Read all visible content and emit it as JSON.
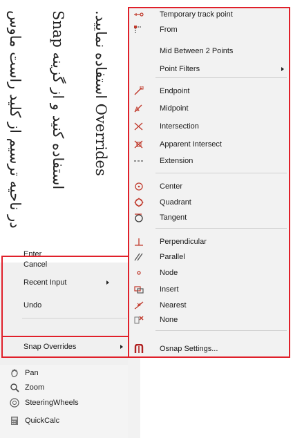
{
  "annotation": {
    "line1": "در ناحیه ترسیم از کلید راست ماوس",
    "line2": "استفاده کنید و از گزینه Snap",
    "line3": "Overrides استفاده نمایید."
  },
  "context_menu": {
    "items": [
      {
        "label": "Enter"
      },
      {
        "label": "Cancel"
      },
      {
        "label": "Recent Input"
      },
      {
        "label": "Undo"
      },
      {
        "label": "Snap Overrides"
      },
      {
        "label": "Pan"
      },
      {
        "label": "Zoom"
      },
      {
        "label": "SteeringWheels"
      },
      {
        "label": "QuickCalc"
      }
    ]
  },
  "snap_submenu": {
    "items": [
      {
        "label": "Temporary track point",
        "icon": "temporary-track-point-icon"
      },
      {
        "label": "From",
        "icon": "from-icon"
      },
      {
        "label": "Mid Between 2 Points",
        "icon": ""
      },
      {
        "label": "Point Filters",
        "icon": ""
      },
      {
        "label": "Endpoint",
        "icon": "endpoint-icon"
      },
      {
        "label": "Midpoint",
        "icon": "midpoint-icon"
      },
      {
        "label": "Intersection",
        "icon": "intersection-icon"
      },
      {
        "label": "Apparent Intersect",
        "icon": "apparent-intersect-icon"
      },
      {
        "label": "Extension",
        "icon": "extension-icon"
      },
      {
        "label": "Center",
        "icon": "center-icon"
      },
      {
        "label": "Quadrant",
        "icon": "quadrant-icon"
      },
      {
        "label": "Tangent",
        "icon": "tangent-icon"
      },
      {
        "label": "Perpendicular",
        "icon": "perpendicular-icon"
      },
      {
        "label": "Parallel",
        "icon": "parallel-icon"
      },
      {
        "label": "Node",
        "icon": "node-icon"
      },
      {
        "label": "Insert",
        "icon": "insert-icon"
      },
      {
        "label": "Nearest",
        "icon": "nearest-icon"
      },
      {
        "label": "None",
        "icon": "none-icon"
      },
      {
        "label": "Osnap Settings...",
        "icon": "osnap-settings-icon"
      }
    ]
  },
  "colors": {
    "highlight_red": "#e0202a",
    "icon_red": "#c0392b",
    "menu_bg": "#f0f0f0"
  }
}
